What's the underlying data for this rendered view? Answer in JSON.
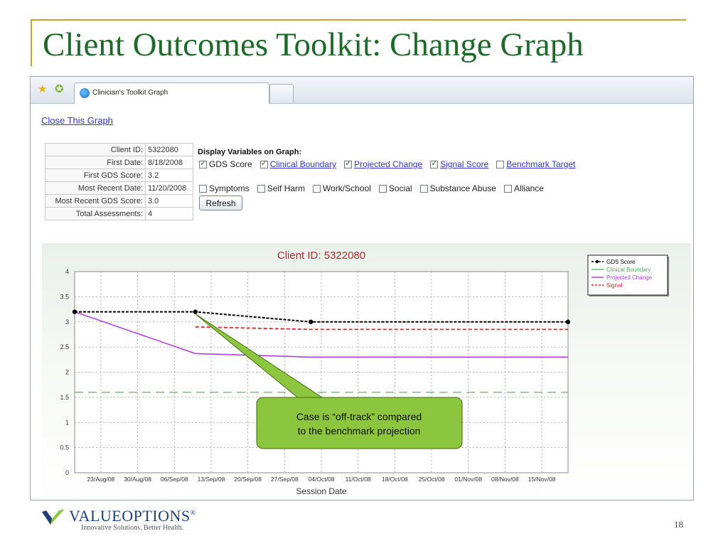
{
  "slide": {
    "title": "Client Outcomes Toolkit: Change Graph",
    "page_number": "18",
    "logo_name": "VALUEOPTIONS",
    "logo_registered": "®",
    "logo_tagline": "Innovative Solutions. Better Health."
  },
  "browser": {
    "tab_title": "Clinician's Toolkit Graph",
    "icons": [
      "favorites-star-icon",
      "add-favorites-icon",
      "ie-page-icon"
    ]
  },
  "page": {
    "close_link": "Close This Graph",
    "client_info": [
      {
        "label": "Client ID:",
        "value": "5322080"
      },
      {
        "label": "First Date:",
        "value": "8/18/2008"
      },
      {
        "label": "First GDS Score:",
        "value": "3.2"
      },
      {
        "label": "Most Recent Date:",
        "value": "11/20/2008"
      },
      {
        "label": "Most Recent GDS Score:",
        "value": "3.0"
      },
      {
        "label": "Total Assessments:",
        "value": "4"
      }
    ],
    "display_variables_title": "Display Variables on Graph:",
    "variables_row1": [
      {
        "label": "GDS Score",
        "checked": true,
        "link": false
      },
      {
        "label": "Clinical Boundary",
        "checked": true,
        "link": true
      },
      {
        "label": "Projected Change",
        "checked": true,
        "link": true
      },
      {
        "label": "Signal Score",
        "checked": true,
        "link": true
      },
      {
        "label": "Benchmark Target",
        "checked": false,
        "link": true
      }
    ],
    "variables_row2": [
      {
        "label": "Symptoms",
        "checked": false
      },
      {
        "label": "Self Harm",
        "checked": false
      },
      {
        "label": "Work/School",
        "checked": false
      },
      {
        "label": "Social",
        "checked": false
      },
      {
        "label": "Substance Abuse",
        "checked": false
      },
      {
        "label": "Alliance",
        "checked": false
      }
    ],
    "refresh_label": "Refresh"
  },
  "callout": {
    "line1": "Case is “off-track” compared",
    "line2": "to the benchmark projection",
    "fill": "#8cc63f"
  },
  "chart_data": {
    "type": "line",
    "title": "Client ID: 5322080",
    "xlabel": "Session Date",
    "ylabel": "",
    "ylim": [
      0,
      4
    ],
    "y_ticks": [
      "0",
      "0.5",
      "1",
      "1.5",
      "2",
      "2.5",
      "3",
      "3.5",
      "4"
    ],
    "x_tick_labels": [
      "23/Aug/08",
      "30/Aug/08",
      "06/Sep/08",
      "13/Sep/08",
      "20/Sep/08",
      "27/Sep/08",
      "04/Oct/08",
      "11/Oct/08",
      "18/Oct/08",
      "25/Oct/08",
      "01/Nov/08",
      "08/Nov/08",
      "15/Nov/08"
    ],
    "x_range": [
      "2008-08-18",
      "2008-11-20"
    ],
    "grid": true,
    "legend_position": "top-right",
    "series": [
      {
        "name": "GDS Score",
        "color": "#000000",
        "style": "dashed-markers",
        "points": [
          [
            "2008-08-18",
            3.2
          ],
          [
            "2008-09-10",
            3.2
          ],
          [
            "2008-10-02",
            3.0
          ],
          [
            "2008-11-20",
            3.0
          ]
        ]
      },
      {
        "name": "Clinical Boundary",
        "color": "#4caf50",
        "style": "long-dash",
        "points": [
          [
            "2008-08-18",
            1.6
          ],
          [
            "2008-11-20",
            1.6
          ]
        ]
      },
      {
        "name": "Projected Change",
        "color": "#b03fe0",
        "style": "solid",
        "points": [
          [
            "2008-08-18",
            3.2
          ],
          [
            "2008-09-10",
            2.37
          ],
          [
            "2008-10-02",
            2.3
          ],
          [
            "2008-11-20",
            2.3
          ]
        ]
      },
      {
        "name": "Signal",
        "color": "#e8202a",
        "style": "dashed",
        "points": [
          [
            "2008-09-10",
            2.9
          ],
          [
            "2008-10-02",
            2.85
          ],
          [
            "2008-11-20",
            2.85
          ]
        ]
      }
    ]
  }
}
